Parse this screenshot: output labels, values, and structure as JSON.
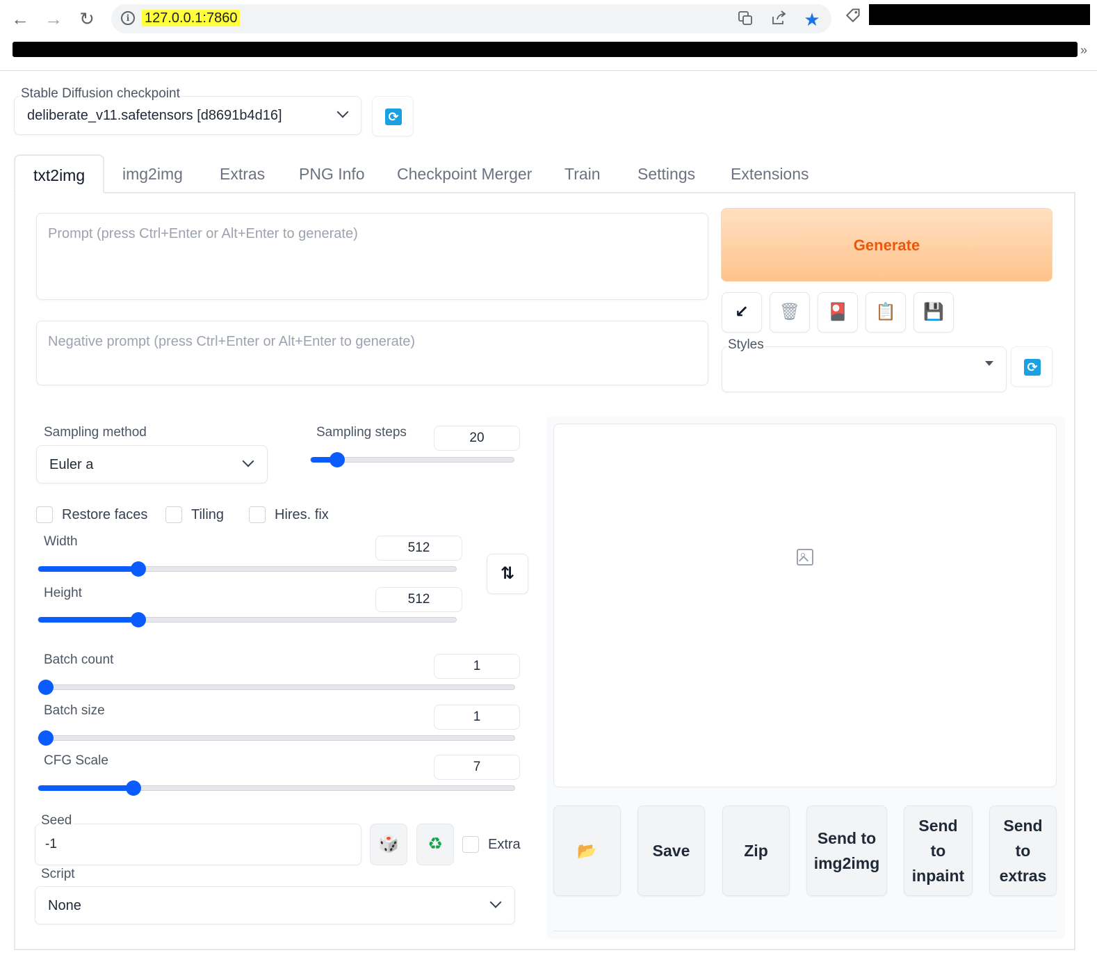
{
  "browser": {
    "url": "127.0.0.1:7860",
    "back_icon": "←",
    "forward_icon": "→",
    "reload_icon": "↻",
    "more_icon": "»"
  },
  "checkpoint": {
    "label": "Stable Diffusion checkpoint",
    "value": "deliberate_v11.safetensors [d8691b4d16]"
  },
  "tabs": [
    {
      "label": "txt2img",
      "active": true
    },
    {
      "label": "img2img"
    },
    {
      "label": "Extras"
    },
    {
      "label": "PNG Info"
    },
    {
      "label": "Checkpoint Merger"
    },
    {
      "label": "Train"
    },
    {
      "label": "Settings"
    },
    {
      "label": "Extensions"
    }
  ],
  "prompt": {
    "placeholder": "Prompt (press Ctrl+Enter or Alt+Enter to generate)",
    "negative_placeholder": "Negative prompt (press Ctrl+Enter or Alt+Enter to generate)"
  },
  "generate_label": "Generate",
  "tools": {
    "read_params": "↙",
    "trash": "🗑",
    "extra_networks": "🎴",
    "apply_style": "📋",
    "save_style": "💾"
  },
  "styles": {
    "label": "Styles",
    "value": ""
  },
  "sampling": {
    "method_label": "Sampling method",
    "method_value": "Euler a",
    "steps_label": "Sampling steps",
    "steps_value": "20",
    "steps_fraction": 0.13
  },
  "checkboxes": {
    "restore_faces": "Restore faces",
    "tiling": "Tiling",
    "hires_fix": "Hires. fix",
    "extra": "Extra"
  },
  "width": {
    "label": "Width",
    "value": "512",
    "fraction": 0.24
  },
  "height": {
    "label": "Height",
    "value": "512",
    "fraction": 0.24
  },
  "swap_icon": "⇅",
  "batch_count": {
    "label": "Batch count",
    "value": "1",
    "fraction": 0.0
  },
  "batch_size": {
    "label": "Batch size",
    "value": "1",
    "fraction": 0.0
  },
  "cfg_scale": {
    "label": "CFG Scale",
    "value": "7",
    "fraction": 0.2
  },
  "seed": {
    "label": "Seed",
    "value": "-1",
    "dice_icon": "🎲",
    "recycle_icon": "♻"
  },
  "script": {
    "label": "Script",
    "value": "None"
  },
  "output_buttons": {
    "folder_icon": "📂",
    "save": "Save",
    "zip": "Zip",
    "send_img2img": "Send to img2img",
    "send_inpaint": "Send to inpaint",
    "send_extras": "Send to extras"
  },
  "colors": {
    "accent": "#0b5cff",
    "generate_text": "#ea580c",
    "url_highlight": "#ffff3c"
  }
}
